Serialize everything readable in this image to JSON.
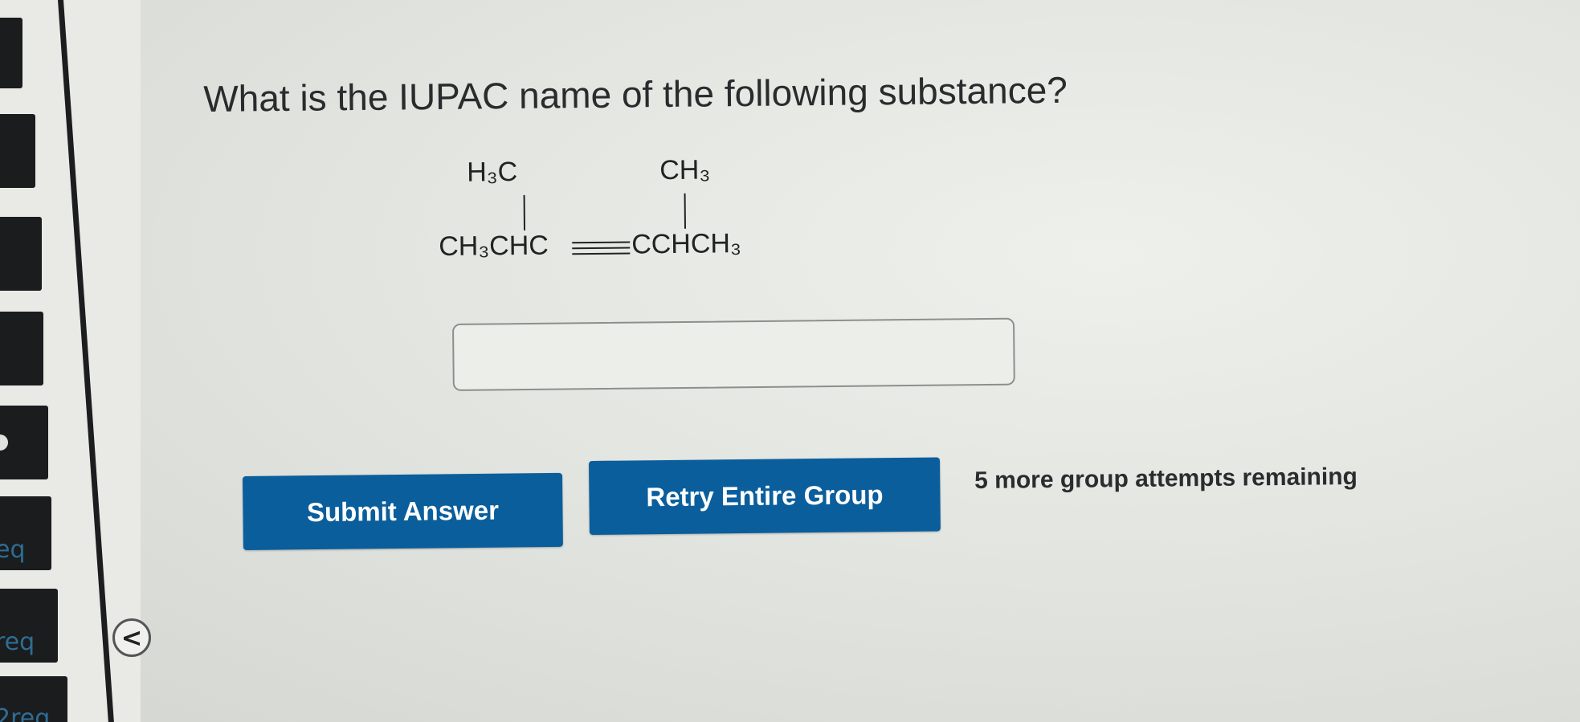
{
  "question": {
    "text": "What is the IUPAC name of the following substance?"
  },
  "structure": {
    "top_left": "H₃C",
    "top_right": "CH₃",
    "main_left": "CH₃CHC",
    "main_right": "CCHCH₃"
  },
  "answer": {
    "value": ""
  },
  "actions": {
    "submit_label": "Submit Answer",
    "retry_label": "Retry Entire Group",
    "attempts_text": "5 more group attempts remaining"
  },
  "sidebar": {
    "tab_labels": [
      "eq",
      "req",
      "2req"
    ],
    "collapse_glyph": "<"
  },
  "colors": {
    "button_bg": "#0a5e9c",
    "button_text": "#ffffff",
    "background": "#e3e5e1"
  }
}
